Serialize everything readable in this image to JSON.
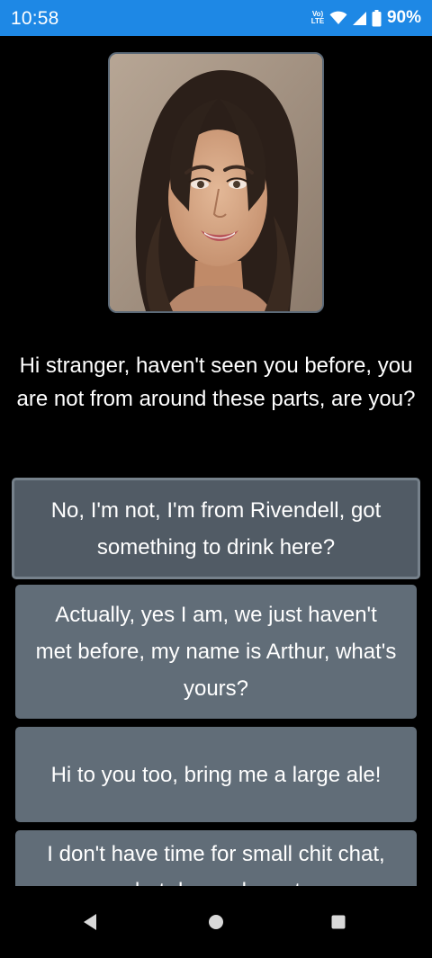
{
  "status_bar": {
    "time": "10:58",
    "volte_label": "Vo) LTE",
    "battery": "90%",
    "icons": [
      "volte-icon",
      "wifi-icon",
      "signal-icon",
      "battery-icon"
    ]
  },
  "npc": {
    "portrait_icon": "woman-portrait",
    "line": "Hi stranger, haven't seen you before, you are not from around these parts, are you?"
  },
  "replies": [
    {
      "text": "No, I'm not, I'm from Rivendell, got something to drink here?",
      "selected": true
    },
    {
      "text": "Actually, yes I am, we just haven't met before, my name is Arthur, what's yours?",
      "selected": false
    },
    {
      "text": "Hi to you too, bring me a large ale!",
      "selected": false
    },
    {
      "text": "I don't have time for small chit chat, what do you have to",
      "selected": false
    }
  ],
  "nav_bar": {
    "icons": [
      "back-icon",
      "home-icon",
      "recents-icon"
    ]
  },
  "colors": {
    "status_bar": "#1e88e5",
    "background": "#000000",
    "reply_bg": "#616d78",
    "reply_selected_bg": "#515b65",
    "text": "#ffffff"
  }
}
